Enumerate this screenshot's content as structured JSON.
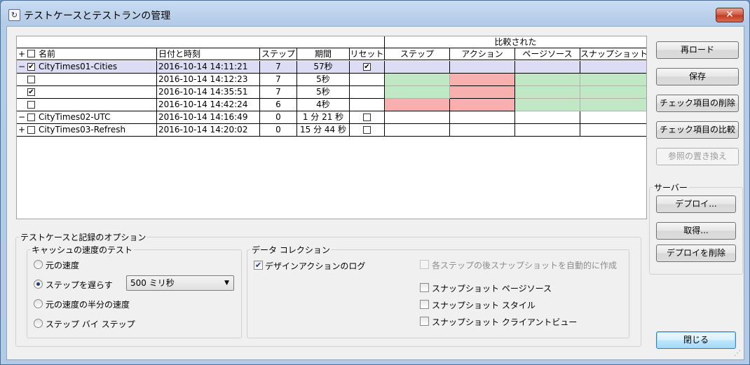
{
  "window": {
    "title": "テストケースとテストランの管理",
    "close_glyph": "✕"
  },
  "grid": {
    "group_header": "比較された",
    "expand_all_glyph": "+",
    "columns": {
      "name": "名前",
      "datetime": "日付と時刻",
      "steps": "ステップ",
      "duration": "期間",
      "reset": "リセット",
      "cmp_steps": "ステップ",
      "cmp_actions": "アクション",
      "cmp_page_source": "ページソース",
      "cmp_snapshot": "スナップショット"
    },
    "rows": [
      {
        "expander": "−",
        "checked": true,
        "name": "CityTimes01-Cities",
        "datetime": "2016-10-14 14:11:21",
        "steps": "7",
        "duration": "57秒",
        "reset": "checked",
        "compare": [
          "lav",
          "lav",
          "lav",
          "lav"
        ],
        "selected": true
      },
      {
        "expander": "",
        "checked": false,
        "name": "",
        "datetime": "2016-10-14 14:12:23",
        "steps": "7",
        "duration": "5秒",
        "reset": "none",
        "compare": [
          "green",
          "red",
          "green",
          "green"
        ]
      },
      {
        "expander": "",
        "checked": true,
        "name": "",
        "datetime": "2016-10-14 14:35:51",
        "steps": "7",
        "duration": "5秒",
        "reset": "none",
        "compare": [
          "green",
          "red",
          "green",
          "green"
        ]
      },
      {
        "expander": "",
        "checked": false,
        "name": "",
        "datetime": "2016-10-14 14:42:24",
        "steps": "6",
        "duration": "4秒",
        "reset": "none",
        "compare": [
          "red",
          "red",
          "green",
          "green"
        ]
      },
      {
        "expander": "−",
        "checked": false,
        "name": "CityTimes02-UTC",
        "datetime": "2016-10-14 14:16:49",
        "steps": "0",
        "duration": "1 分 21 秒",
        "reset": "unchecked",
        "compare": [
          "",
          "",
          "",
          ""
        ]
      },
      {
        "expander": "+",
        "checked": false,
        "name": "CityTimes03-Refresh",
        "datetime": "2016-10-14 14:20:02",
        "steps": "0",
        "duration": "15 分 44 秒",
        "reset": "unchecked",
        "compare": [
          "",
          "",
          "",
          ""
        ]
      }
    ]
  },
  "buttons": {
    "reload": "再ロード",
    "save": "保存",
    "delete_checked": "チェック項目の削除",
    "compare_checked": "チェック項目の比較",
    "replace_reference": "参照の置き換え",
    "deploy": "デプロイ...",
    "retrieve": "取得...",
    "delete_deploy": "デプロイを削除",
    "close": "閉じる"
  },
  "server_group": {
    "label": "サーバー"
  },
  "options": {
    "label": "テストケースと記録のオプション",
    "cache_speed": {
      "label": "キャッシュの速度のテスト",
      "original_speed": "元の速度",
      "slow_steps": "ステップを遅らす",
      "half_speed": "元の速度の半分の速度",
      "step_by_step": "ステップ バイ ステップ",
      "selected": "slow_steps",
      "delay_value": "500 ミリ秒"
    },
    "data_collection": {
      "label": "データ コレクション",
      "log_design_actions": "デザインアクションのログ",
      "log_design_actions_checked": true,
      "auto_snapshot": "各ステップの後スナップショットを自動的に作成",
      "snapshot_page_source": "スナップショット ページソース",
      "snapshot_style": "スナップショット スタイル",
      "snapshot_client_view": "スナップショット クライアントビュー"
    }
  },
  "colors": {
    "pass": "#c0e8c4",
    "fail": "#f7b0ae",
    "selected_row": "#dcdcf5",
    "title_bg": "#c9dcf2"
  }
}
